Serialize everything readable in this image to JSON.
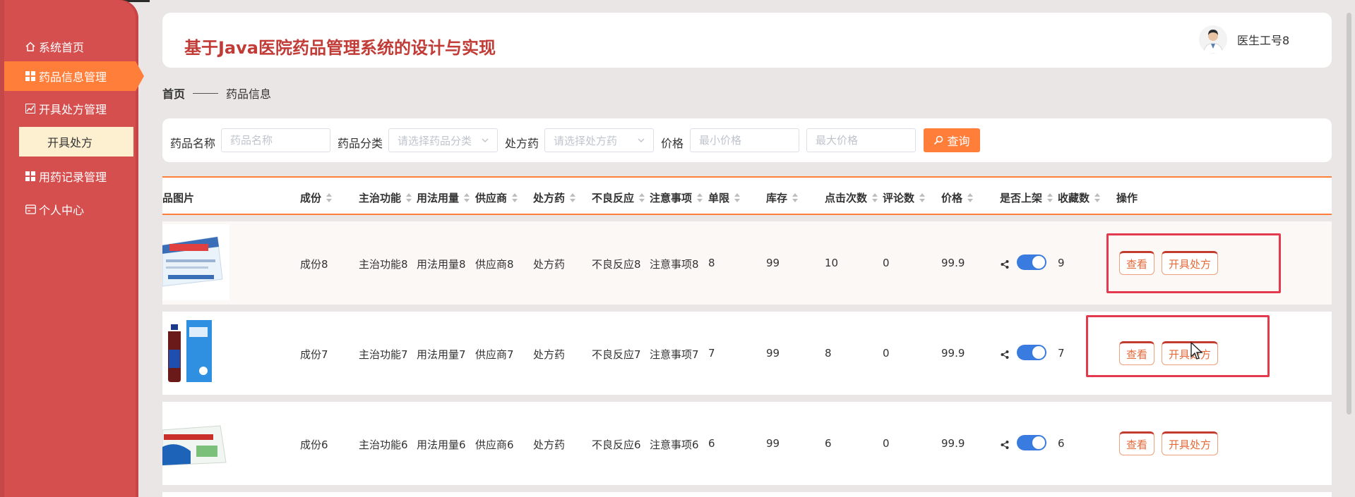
{
  "app": {
    "title": "基于Java医院药品管理系统的设计与实现",
    "user_name": "医生工号8"
  },
  "sidebar": {
    "items": [
      {
        "label": "系统首页",
        "icon": "home-icon"
      },
      {
        "label": "药品信息管理",
        "icon": "grid-icon",
        "active": true
      },
      {
        "label": "开具处方管理",
        "icon": "chart-icon"
      },
      {
        "label": "开具处方",
        "sub": true
      },
      {
        "label": "用药记录管理",
        "icon": "grid-icon"
      },
      {
        "label": "个人中心",
        "icon": "card-icon"
      }
    ]
  },
  "breadcrumb": {
    "home": "首页",
    "current": "药品信息"
  },
  "search": {
    "name_label": "药品名称",
    "name_placeholder": "药品名称",
    "category_label": "药品分类",
    "category_placeholder": "请选择药品分类",
    "rx_label": "处方药",
    "rx_placeholder": "请选择处方药",
    "price_label": "价格",
    "min_price_placeholder": "最小价格",
    "max_price_placeholder": "最大价格",
    "query_label": "查询"
  },
  "table": {
    "headers": {
      "image": "品图片",
      "composition": "成份",
      "function": "主治功能",
      "dosage": "用法用量",
      "supplier": "供应商",
      "rx": "处方药",
      "adverse": "不良反应",
      "notes": "注意事项",
      "limit": "单限",
      "stock": "库存",
      "clicks": "点击次数",
      "comments": "评论数",
      "price": "价格",
      "listed": "是否上架",
      "favorites": "收藏数",
      "actions": "操作"
    },
    "rows": [
      {
        "composition": "成份8",
        "function": "主治功能8",
        "dosage": "用法用量8",
        "supplier": "供应商8",
        "rx": "处方药",
        "adverse": "不良反应8",
        "notes": "注意事项8",
        "limit": "8",
        "stock": "99",
        "clicks": "10",
        "comments": "0",
        "price": "99.9",
        "listed": true,
        "favorites": "9"
      },
      {
        "composition": "成份7",
        "function": "主治功能7",
        "dosage": "用法用量7",
        "supplier": "供应商7",
        "rx": "处方药",
        "adverse": "不良反应7",
        "notes": "注意事项7",
        "limit": "7",
        "stock": "99",
        "clicks": "8",
        "comments": "0",
        "price": "99.9",
        "listed": true,
        "favorites": "7"
      },
      {
        "composition": "成份6",
        "function": "主治功能6",
        "dosage": "用法用量6",
        "supplier": "供应商6",
        "rx": "处方药",
        "adverse": "不良反应6",
        "notes": "注意事项6",
        "limit": "6",
        "stock": "99",
        "clicks": "6",
        "comments": "0",
        "price": "99.9",
        "listed": true,
        "favorites": "6"
      }
    ],
    "action_view": "查看",
    "action_prescribe": "开具处方"
  },
  "colors": {
    "sidebar": "#d64f4f",
    "accent": "#ff7e3a",
    "title": "#c13b37",
    "submenu": "#fdf0d1",
    "toggle": "#3a7be0",
    "highlight": "#e43a4f"
  }
}
